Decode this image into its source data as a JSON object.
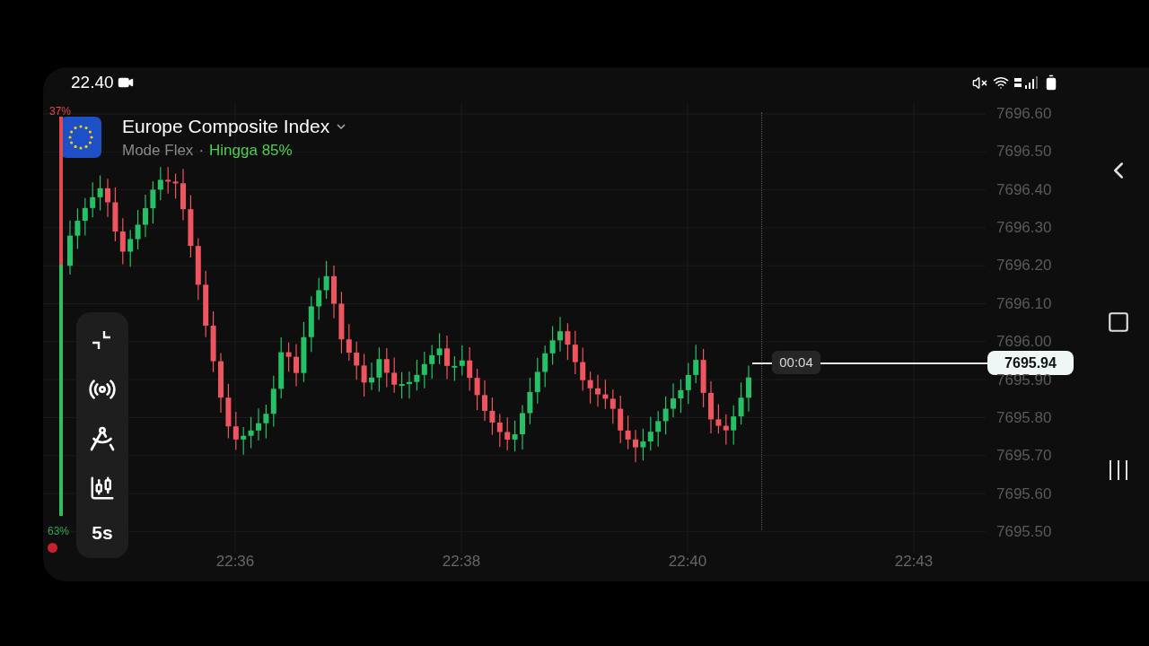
{
  "status_bar": {
    "time": "22.40"
  },
  "asset": {
    "name": "Europe Composite Index",
    "mode": "Mode Flex",
    "separator": "·",
    "payout": "Hingga 85%"
  },
  "sentiment": {
    "top_label": "37%",
    "bottom_label": "63%",
    "level": 0.63
  },
  "y_axis": [
    "7696.60",
    "7696.50",
    "7696.40",
    "7696.30",
    "7696.20",
    "7696.10",
    "7696.00",
    "7695.90",
    "7695.80",
    "7695.70",
    "7695.60",
    "7695.50"
  ],
  "x_axis": [
    "22:36",
    "22:38",
    "22:40",
    "22:43"
  ],
  "timer": "00:04",
  "current_price": "7695.94",
  "toolbar": {
    "timeframe": "5s"
  }
}
